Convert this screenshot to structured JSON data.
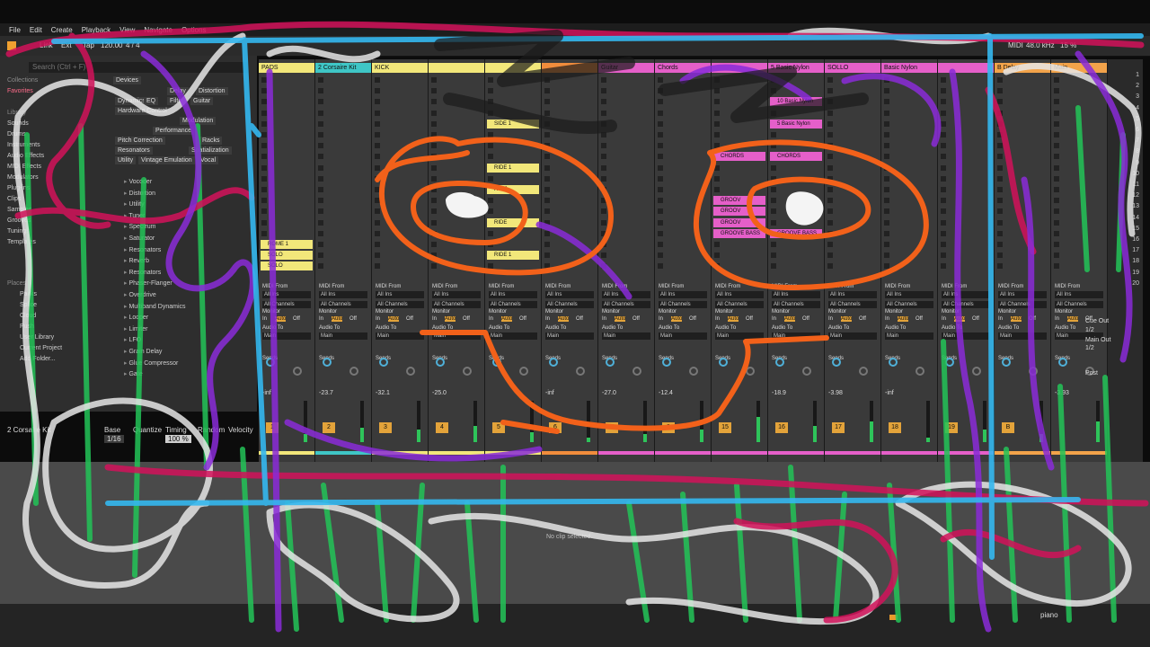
{
  "menu": [
    "File",
    "Edit",
    "Create",
    "Playback",
    "View",
    "Navigate",
    "Options"
  ],
  "transport": {
    "link": "Link",
    "ext": "Ext",
    "tap": "Tap",
    "tempo": "120.00",
    "sig": "4 / 4",
    "midi": "MIDI",
    "sample_rate": "48.0 kHz",
    "cpu": "15 %"
  },
  "browser": {
    "search_placeholder": "Search (Ctrl + F)",
    "collections_header": "Collections",
    "favorites": "Favorites",
    "library_header": "Library",
    "library_items": [
      "Sounds",
      "Drums",
      "Instruments",
      "Audio Effects",
      "MIDI Effects",
      "Modulators",
      "Plug-ins",
      "Clips",
      "Samples",
      "Grooves",
      "Tunings",
      "Templates"
    ],
    "devices_label": "Devices",
    "tags": [
      "Delay",
      "Distortion",
      "Dynamics",
      "EQ",
      "Filter",
      "Guitar",
      "Hardware Control",
      "Modulation",
      "Performance",
      "Pitch Correction",
      "Racks",
      "Resonators",
      "Spatialization",
      "Utility",
      "Vintage Emulation",
      "Vocal"
    ],
    "places_header": "Places",
    "places": [
      "Packs",
      "Splice",
      "Cloud",
      "Push",
      "User Library",
      "Current Project",
      "Add Folder..."
    ],
    "list": [
      "Vocoder",
      "Distortion",
      "Utility",
      "Tuner",
      "Spectrum",
      "Saturator",
      "Resonators",
      "Reverb",
      "Resonators",
      "Phaser-Flanger",
      "Overdrive",
      "Multiband Dynamics",
      "Looper",
      "Limiter",
      "LFO",
      "Grain Delay",
      "Glue Compressor",
      "Gate"
    ]
  },
  "detail": {
    "clip_name": "2 Corsaire Kit",
    "base_label": "Base",
    "quantize_label": "Quantize",
    "timing_label": "Timing",
    "random_label": "Random",
    "velocity_label": "Velocity",
    "base_value": "1/16",
    "amount": "100 %",
    "empty_message": "No clip selected."
  },
  "tracks": [
    {
      "name": "PADS",
      "color": "#f2e77a",
      "clips": [
        "",
        "",
        "",
        "",
        "",
        "",
        "",
        "",
        "",
        "",
        "",
        "",
        "",
        "",
        "",
        "ROME 1",
        "SOLO",
        "SOLO"
      ],
      "vol": "-inf",
      "num": "1",
      "meter": 0.2
    },
    {
      "name": "2 Corsaire Kit",
      "color": "#3fc6c6",
      "clips": [
        "",
        "",
        "",
        "",
        "",
        "",
        "",
        "",
        "",
        "",
        "",
        "",
        "",
        "",
        "",
        "",
        "",
        ""
      ],
      "vol": "-23.7",
      "num": "2",
      "meter": 0.35
    },
    {
      "name": "KICK",
      "color": "#f2e77a",
      "clips": [
        "",
        "",
        "",
        "",
        "",
        "",
        "",
        "",
        "",
        "",
        "",
        "",
        "",
        "",
        "",
        "",
        "",
        ""
      ],
      "vol": "-32.1",
      "num": "3",
      "meter": 0.3
    },
    {
      "name": "",
      "color": "#f2e77a",
      "clips": [
        "",
        "",
        "",
        "",
        "",
        "",
        "",
        "",
        "",
        "",
        "",
        "",
        "",
        "",
        "",
        "",
        "",
        ""
      ],
      "vol": "-25.0",
      "num": "4",
      "meter": 0.4
    },
    {
      "name": "",
      "color": "#f2e77a",
      "clips": [
        "",
        "",
        "",
        "",
        "SIDE 1",
        "",
        "",
        "",
        "RIDE 1",
        "",
        "RIDE",
        "",
        "",
        "RIDE",
        "",
        "",
        "RIDE 1",
        ""
      ],
      "vol": "",
      "num": "5",
      "meter": 0.25
    },
    {
      "name": "",
      "color": "#f08c3c",
      "clips": [
        "",
        "",
        "",
        "",
        "",
        "",
        "",
        "",
        "",
        "",
        "",
        "",
        "",
        "",
        "",
        "",
        "",
        ""
      ],
      "vol": "-inf",
      "num": "6",
      "meter": 0.1
    },
    {
      "name": "Guitar",
      "color": "#e55fc9",
      "clips": [
        "",
        "",
        "",
        "",
        "",
        "",
        "",
        "",
        "",
        "",
        "",
        "",
        "",
        "",
        "",
        "",
        "",
        ""
      ],
      "vol": "-27.0",
      "num": "7",
      "meter": 0.2
    },
    {
      "name": "Chords",
      "color": "#e55fc9",
      "clips": [
        "",
        "",
        "",
        "",
        "",
        "",
        "",
        "",
        "",
        "",
        "",
        "",
        "",
        "",
        "",
        "",
        "",
        ""
      ],
      "vol": "-12.4",
      "num": "8",
      "meter": 0.3
    },
    {
      "name": "",
      "color": "#e55fc9",
      "clips": [
        "",
        "",
        "",
        "",
        "",
        "",
        "",
        "CHORDS",
        "",
        "",
        "",
        "GROOV",
        "GROOV",
        "GROOV",
        "GROOVE BASS",
        "",
        "",
        ""
      ],
      "vol": "",
      "num": "15",
      "meter": 0.6
    },
    {
      "name": "5 Basic Nylon",
      "color": "#e55fc9",
      "clips": [
        "",
        "",
        "10 Basic Nylon",
        "",
        "5 Basic Nylon",
        "",
        "",
        "CHORDS",
        "",
        "",
        "",
        "",
        "",
        "",
        "GROOVE BASS",
        "",
        "",
        ""
      ],
      "vol": "-18.9",
      "num": "16",
      "meter": 0.4
    },
    {
      "name": "SOLLO",
      "color": "#e55fc9",
      "clips": [
        "",
        "",
        "",
        "",
        "",
        "",
        "",
        "",
        "",
        "",
        "",
        "",
        "",
        "",
        "",
        "",
        "",
        ""
      ],
      "vol": "-3.98",
      "num": "17",
      "meter": 0.5
    },
    {
      "name": "Basic Nylon",
      "color": "#e55fc9",
      "clips": [
        "",
        "",
        "",
        "",
        "",
        "",
        "",
        "",
        "",
        "",
        "",
        "",
        "",
        "",
        "",
        "",
        "",
        ""
      ],
      "vol": "-inf",
      "num": "18",
      "meter": 0.1
    },
    {
      "name": "",
      "color": "#e55fc9",
      "clips": [
        "",
        "",
        "",
        "",
        "",
        "",
        "",
        "",
        "",
        "",
        "",
        "",
        "",
        "",
        "",
        "",
        "",
        ""
      ],
      "vol": "",
      "num": "19",
      "meter": 0.3
    },
    {
      "name": "B Delay",
      "color": "#f2a34a",
      "clips": [
        "",
        "",
        "",
        "",
        "",
        "",
        "",
        "",
        "",
        "",
        "",
        "",
        "",
        "",
        "",
        "",
        "",
        ""
      ],
      "vol": "",
      "num": "B",
      "meter": 0.2
    },
    {
      "name": "Main",
      "color": "#f2a34a",
      "clips": [
        "",
        "",
        "",
        "",
        "",
        "",
        "",
        "",
        "",
        "",
        "",
        "",
        "",
        "",
        "",
        "",
        "",
        ""
      ],
      "vol": "-3.93",
      "num": "",
      "meter": 0.5
    }
  ],
  "mixer_labels": {
    "midi_from": "MIDI From",
    "all_ins": "All Ins",
    "all_channels": "All Channels",
    "monitor": "Monitor",
    "in": "In",
    "auto": "Auto",
    "off": "Off",
    "audio_to": "Audio To",
    "main": "Main",
    "sends": "Sends",
    "cue_out": "Cue Out",
    "main_out": "Main Out",
    "out_value": "1/2",
    "post": "Post"
  },
  "scenes": [
    "1",
    "2",
    "3",
    "4",
    "5",
    "6",
    "7",
    "8",
    "9",
    "10",
    "11",
    "12",
    "13",
    "14",
    "15",
    "16",
    "17",
    "18",
    "19",
    "20"
  ],
  "status": {
    "track_label": "piano"
  }
}
